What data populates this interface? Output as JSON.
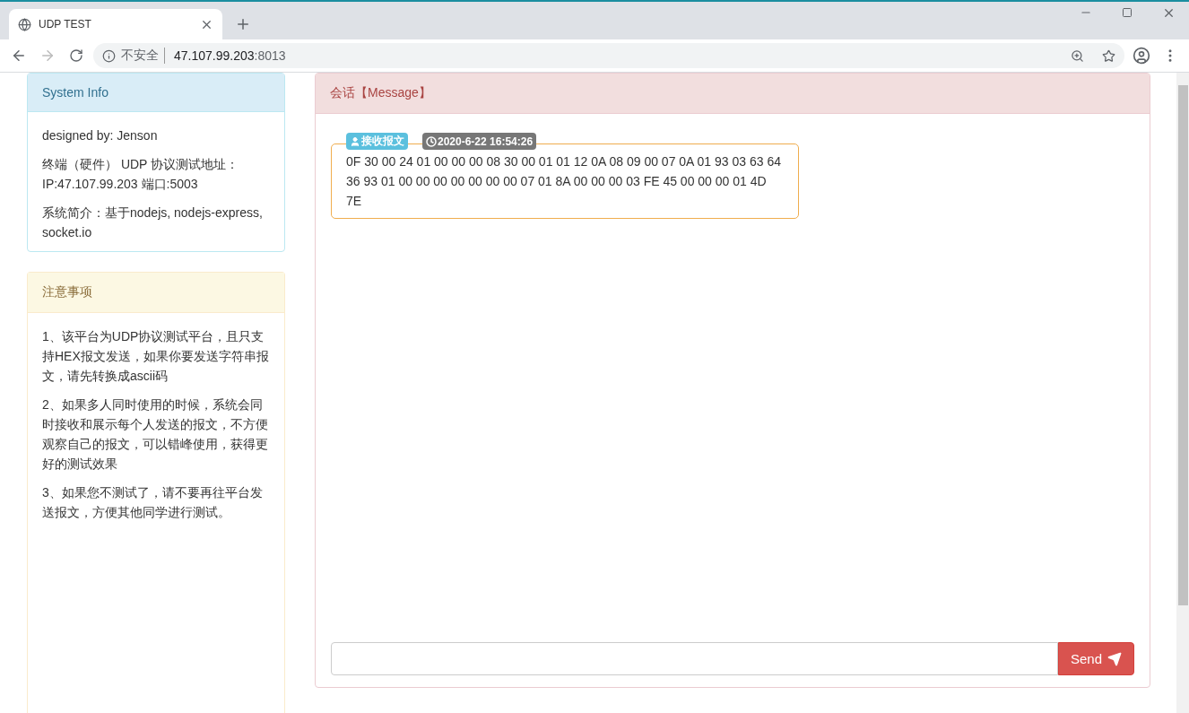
{
  "browser": {
    "tab_title": "UDP TEST",
    "security_label": "不安全",
    "url_host": "47.107.99.203",
    "url_port": ":8013"
  },
  "system_info": {
    "title": "System Info",
    "paragraphs": [
      "designed by: Jenson",
      "终端（硬件） UDP 协议测试地址：IP:47.107.99.203 端口:5003",
      "系统简介：基于nodejs, nodejs-express, socket.io"
    ]
  },
  "notes": {
    "title": "注意事项",
    "paragraphs": [
      "1、该平台为UDP协议测试平台，且只支持HEX报文发送，如果你要发送字符串报文，请先转换成ascii码",
      "2、如果多人同时使用的时候，系统会同时接收和展示每个人发送的报文，不方便观察自己的报文，可以错峰使用，获得更好的测试效果",
      "3、如果您不测试了，请不要再往平台发送报文，方便其他同学进行测试。"
    ]
  },
  "chat": {
    "title": "会话【Message】",
    "messages": [
      {
        "kind": "received",
        "label": "接收报文",
        "time": "2020-6-22 16:54:26",
        "body": "0F 30 00 24 01 00 00 00 08 30 00 01 01 12 0A 08 09 00 07 0A 01 93 03 63 64 36 93 01 00 00 00 00 00 00 00 07 01 8A 00 00 00 03 FE 45 00 00 00 01 4D 7E"
      }
    ],
    "send_button": "Send"
  }
}
